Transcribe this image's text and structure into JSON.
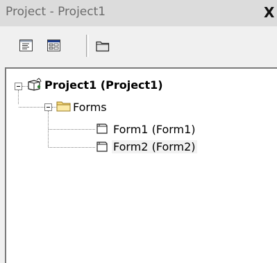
{
  "window": {
    "title": "Project - Project1",
    "close_glyph": "X"
  },
  "toolbar": {
    "buttons": [
      {
        "name": "view-code",
        "icon": "view-code-icon"
      },
      {
        "name": "view-object",
        "icon": "view-object-icon"
      },
      {
        "name": "toggle-folders",
        "icon": "folder-icon"
      }
    ]
  },
  "tree": {
    "root": {
      "label": "Project1 (Project1)",
      "icon": "project-icon",
      "expanded": true
    },
    "folder": {
      "label": "Forms",
      "icon": "folder-icon",
      "expanded": true
    },
    "items": [
      {
        "label": "Form1 (Form1)",
        "icon": "form-icon"
      },
      {
        "label": "Form2 (Form2)",
        "icon": "form-icon",
        "selected": true
      }
    ]
  }
}
